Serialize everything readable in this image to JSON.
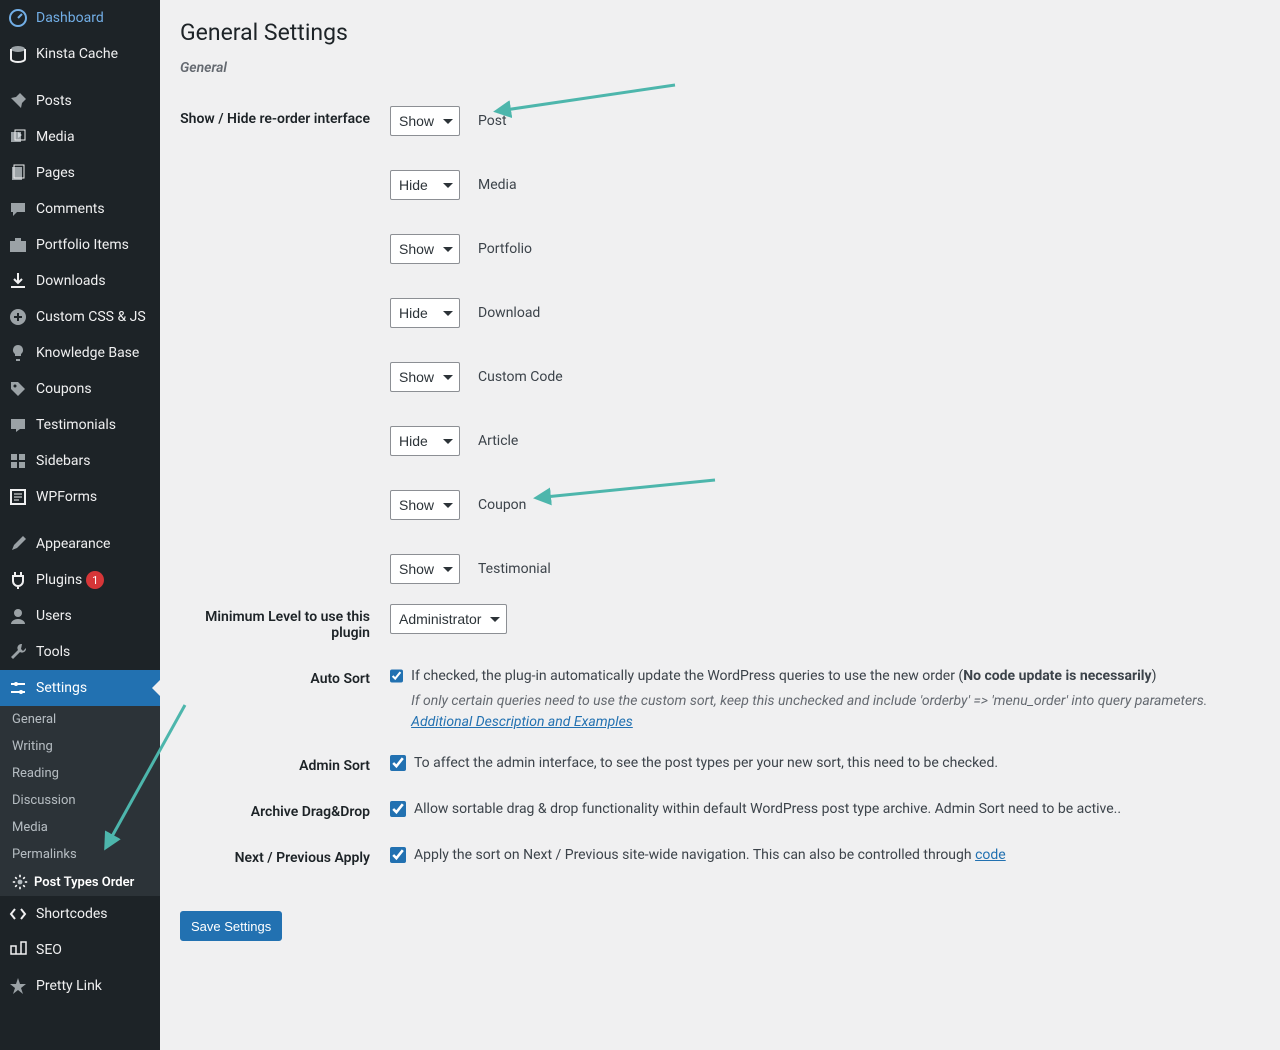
{
  "sidebar": {
    "items": [
      {
        "label": "Dashboard"
      },
      {
        "label": "Kinsta Cache"
      },
      {
        "label": "Posts"
      },
      {
        "label": "Media"
      },
      {
        "label": "Pages"
      },
      {
        "label": "Comments"
      },
      {
        "label": "Portfolio Items"
      },
      {
        "label": "Downloads"
      },
      {
        "label": "Custom CSS & JS"
      },
      {
        "label": "Knowledge Base"
      },
      {
        "label": "Coupons"
      },
      {
        "label": "Testimonials"
      },
      {
        "label": "Sidebars"
      },
      {
        "label": "WPForms"
      },
      {
        "label": "Appearance"
      },
      {
        "label": "Plugins",
        "badge": "1"
      },
      {
        "label": "Users"
      },
      {
        "label": "Tools"
      },
      {
        "label": "Settings"
      },
      {
        "label": "Shortcodes"
      },
      {
        "label": "SEO"
      },
      {
        "label": "Pretty Link"
      }
    ],
    "settings_submenu": [
      {
        "label": "General"
      },
      {
        "label": "Writing"
      },
      {
        "label": "Reading"
      },
      {
        "label": "Discussion"
      },
      {
        "label": "Media"
      },
      {
        "label": "Permalinks"
      },
      {
        "label": "Post Types Order",
        "active": true
      }
    ]
  },
  "main": {
    "page_title": "General Settings",
    "section_title": "General",
    "row_reorder_label": "Show / Hide re-order interface",
    "select_options": [
      "Show",
      "Hide"
    ],
    "post_types": [
      {
        "value": "Show",
        "label": "Post"
      },
      {
        "value": "Hide",
        "label": "Media"
      },
      {
        "value": "Show",
        "label": "Portfolio"
      },
      {
        "value": "Hide",
        "label": "Download"
      },
      {
        "value": "Show",
        "label": "Custom Code"
      },
      {
        "value": "Hide",
        "label": "Article"
      },
      {
        "value": "Show",
        "label": "Coupon"
      },
      {
        "value": "Show",
        "label": "Testimonial"
      }
    ],
    "row_minlevel_label": "Minimum Level to use this plugin",
    "minlevel_value": "Administrator",
    "row_autosort_label": "Auto Sort",
    "autosort_text_pre": "If checked, the plug-in automatically update the WordPress queries to use the new order (",
    "autosort_text_bold": "No code update is necessarily",
    "autosort_text_post": ")",
    "autosort_hint": "If only certain queries need to use the custom sort, keep this unchecked and include 'orderby' => 'menu_order' into query parameters.",
    "autosort_link_text": "Additional Description and Examples",
    "row_adminsort_label": "Admin Sort",
    "adminsort_text": "To affect the admin interface, to see the post types per your new sort, this need to be checked.",
    "row_dragdrop_label": "Archive Drag&Drop",
    "dragdrop_text": "Allow sortable drag & drop functionality within default WordPress post type archive. Admin Sort need to be active..",
    "row_nextprev_label": "Next / Previous Apply",
    "nextprev_text_pre": "Apply the sort on Next / Previous site-wide navigation. This can also be controlled through ",
    "nextprev_link_text": "code",
    "save_button": "Save Settings"
  }
}
